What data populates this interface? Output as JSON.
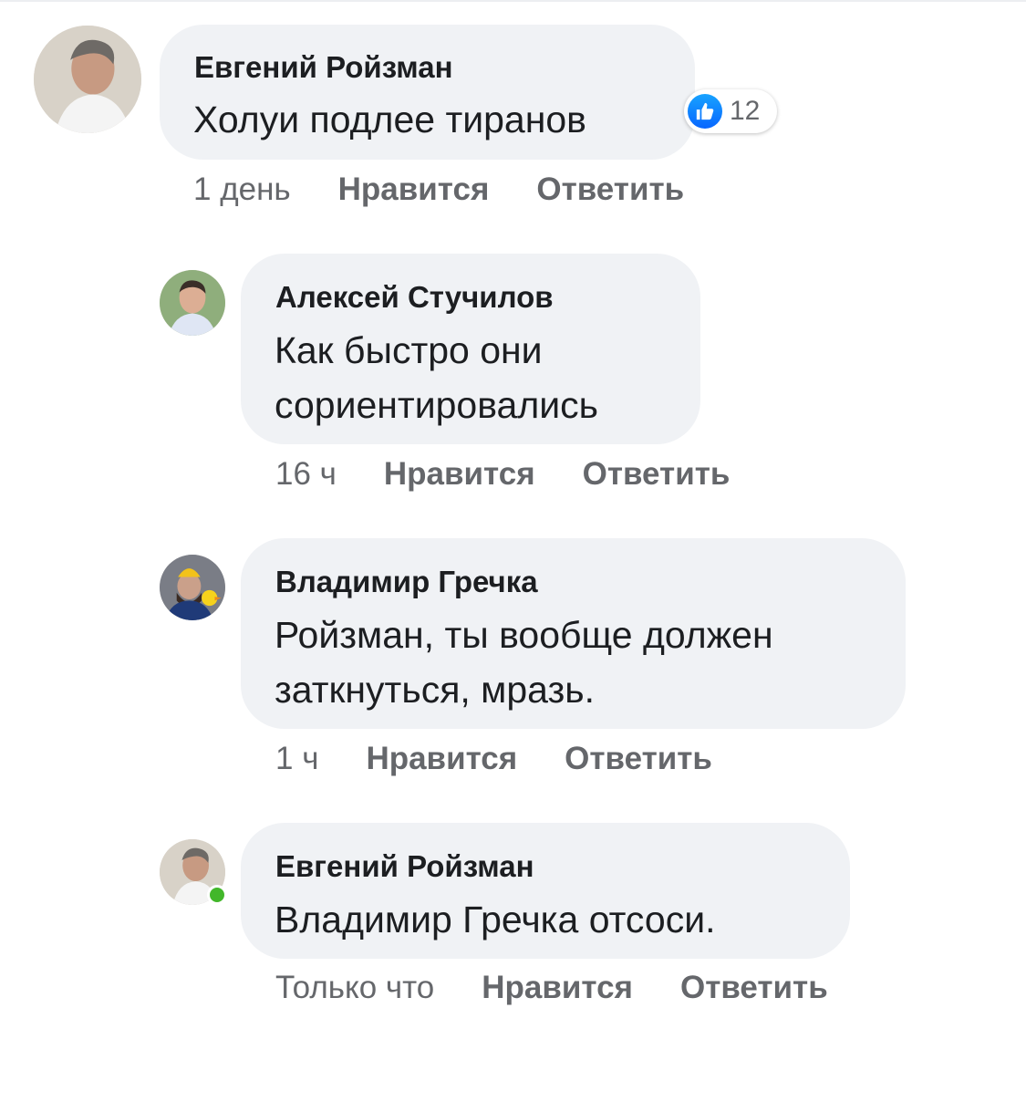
{
  "comments": [
    {
      "author": "Евгений Ройзман",
      "lines": [
        "Холуи подлее тиранов"
      ],
      "reaction": {
        "icon": "like-icon",
        "count": "12"
      },
      "time": "1 день",
      "like_label": "Нравится",
      "reply_label": "Ответить"
    },
    {
      "author": "Алексей Стучилов",
      "lines": [
        "Как быстро они",
        "сориентировались"
      ],
      "time": "16 ч",
      "like_label": "Нравится",
      "reply_label": "Ответить"
    },
    {
      "author": "Владимир Гречка",
      "lines": [
        "Ройзман, ты вообще должен",
        "заткнуться, мразь."
      ],
      "time": "1 ч",
      "like_label": "Нравится",
      "reply_label": "Ответить"
    },
    {
      "author": "Евгений Ройзман",
      "lines": [
        "Владимир Гречка  отсоси."
      ],
      "time": "Только что",
      "like_label": "Нравится",
      "reply_label": "Ответить",
      "online": true
    }
  ],
  "colors": {
    "bubble": "#f0f2f5",
    "meta_text": "#65676b",
    "like_blue": "#0866ff",
    "online_green": "#42b72a"
  }
}
